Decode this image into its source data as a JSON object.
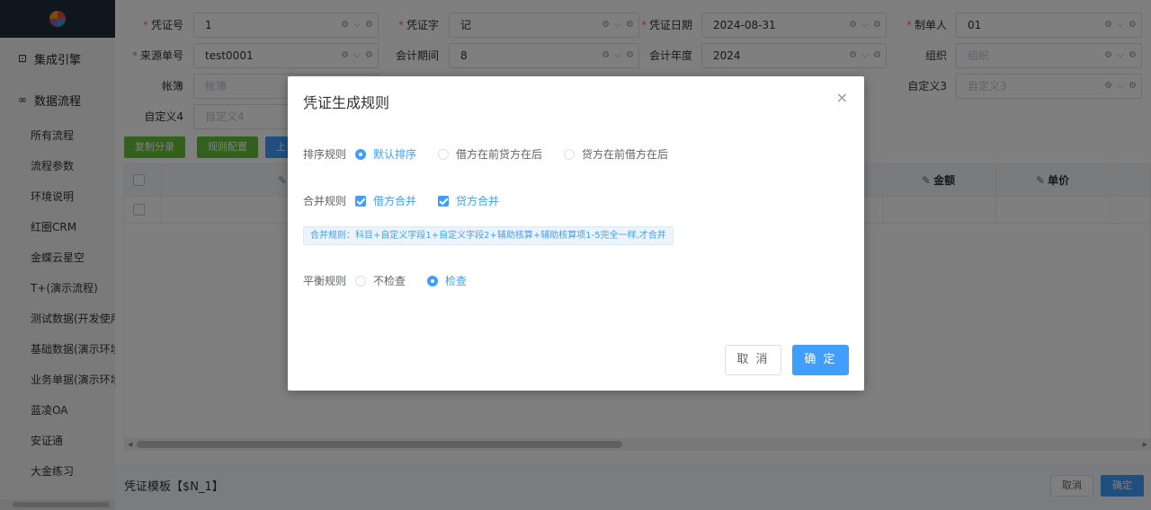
{
  "sidebar": {
    "sections": [
      {
        "label": "集成引擎",
        "icon": "engine-icon",
        "glyph": "⊡"
      },
      {
        "label": "数据流程",
        "icon": "infinity-icon",
        "glyph": "∞"
      }
    ],
    "items": [
      "所有流程",
      "流程参数",
      "环境说明",
      "红圈CRM",
      "金蝶云星空",
      "T+(演示流程)",
      "测试数据(开发使用",
      "基础数据(演示环境",
      "业务单据(演示环境",
      "蓝凌OA",
      "安证通",
      "大金练习"
    ]
  },
  "form": {
    "row1": [
      {
        "label": "凭证号",
        "required": true,
        "value": "1"
      },
      {
        "label": "凭证字",
        "required": true,
        "value": "记"
      },
      {
        "label": "凭证日期",
        "required": true,
        "value": "2024-08-31"
      },
      {
        "label": "制单人",
        "required": true,
        "value": "01"
      }
    ],
    "row2": [
      {
        "label": "来源单号",
        "required": true,
        "value": "test0001"
      },
      {
        "label": "会计期间",
        "required": false,
        "value": "8"
      },
      {
        "label": "会计年度",
        "required": false,
        "value": "2024"
      },
      {
        "label": "组织",
        "required": false,
        "placeholder": "组织"
      }
    ],
    "row3": [
      {
        "label": "帐簿",
        "placeholder": "帐簿"
      },
      {
        "label": "自定义3",
        "placeholder": "自定义3"
      }
    ],
    "row4": [
      {
        "label": "自定义4",
        "placeholder": "自定义4"
      }
    ],
    "tool_glyphs": "⚙ ⌵ ⚙"
  },
  "toolbar": {
    "copy_label": "复制分录",
    "rule_label": "规则配置",
    "third_label": "上"
  },
  "grid": {
    "edit_glyph": "✎",
    "columns": [
      "金额",
      "单价"
    ]
  },
  "footer": {
    "template": "凭证模板【$N_1】",
    "cancel": "取消",
    "ok": "确定"
  },
  "dialog": {
    "title": "凭证生成规则",
    "close_glyph": "×",
    "sort": {
      "label": "排序规则",
      "options": [
        "默认排序",
        "借方在前贷方在后",
        "贷方在前借方在后"
      ],
      "selected": 0
    },
    "merge": {
      "label": "合并规则",
      "options": [
        "借方合并",
        "贷方合并"
      ],
      "tip": "合并规则：科目+自定义字段1+自定义字段2+辅助核算+辅助核算项1-5完全一样,才合并"
    },
    "balance": {
      "label": "平衡规则",
      "options": [
        "不检查",
        "检查"
      ],
      "selected": 1
    },
    "cancel": "取 消",
    "ok": "确 定"
  },
  "colors": {
    "primary": "#409eff",
    "green": "#67c23a",
    "required": "#f56c6c"
  }
}
